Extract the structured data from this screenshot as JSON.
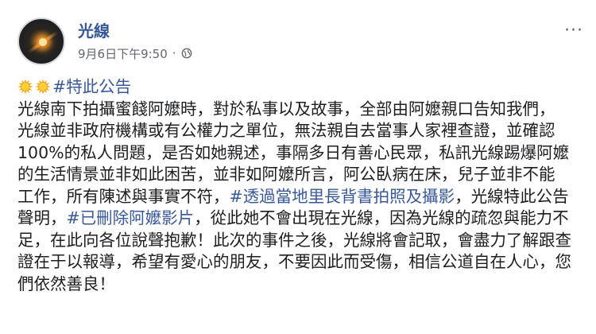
{
  "post": {
    "page_name": "光線",
    "timestamp": "9月6日下午9:50",
    "separator": "·",
    "icons": {
      "avatar": "sun-flare-avatar",
      "privacy": "globe-icon",
      "more": "more-options-icon",
      "emoji": "sun-emoji-icon"
    },
    "lines": [
      {
        "pre": "",
        "tag": "#特此公告",
        "post": ""
      },
      {
        "pre": "光線南下拍攝蜜餞阿嬤時，對於私事以及故事，全部由阿嬤親口告知我們，",
        "tag": "",
        "post": ""
      },
      {
        "pre": "光線並非政府機構或有公權力之單位，無法親自去當事人家裡查證，並確認",
        "tag": "",
        "post": ""
      },
      {
        "pre": "100%的私人問題，是否如她親述，事隔多日有善心民眾，私訊光線踢爆阿嬤",
        "tag": "",
        "post": ""
      },
      {
        "pre": "的生活情景並非如此困苦，並非如阿嬤所言，阿公臥病在床，兒子並非不能",
        "tag": "",
        "post": ""
      },
      {
        "pre": "工作，所有陳述與事實不符，",
        "tag": "#透過當地里長背書拍照及攝影",
        "post": "，光線特此公告"
      },
      {
        "pre": "聲明，",
        "tag": "#已刪除阿嬤影片",
        "post": "，從此她不會出現在光線，因為光線的疏忽與能力不"
      },
      {
        "pre": "足，在此向各位說聲抱歉！此次的事件之後，光線將會記取，會盡力了解跟查",
        "tag": "",
        "post": ""
      },
      {
        "pre": "證在于以報導，希望有愛心的朋友，不要因此而受傷，相信公道自在人心，您",
        "tag": "",
        "post": ""
      },
      {
        "pre": "們依然善良！",
        "tag": "",
        "post": ""
      }
    ],
    "colors": {
      "link": "#385898",
      "name": "#365899",
      "text": "#1c1e21",
      "meta": "#616770"
    }
  }
}
